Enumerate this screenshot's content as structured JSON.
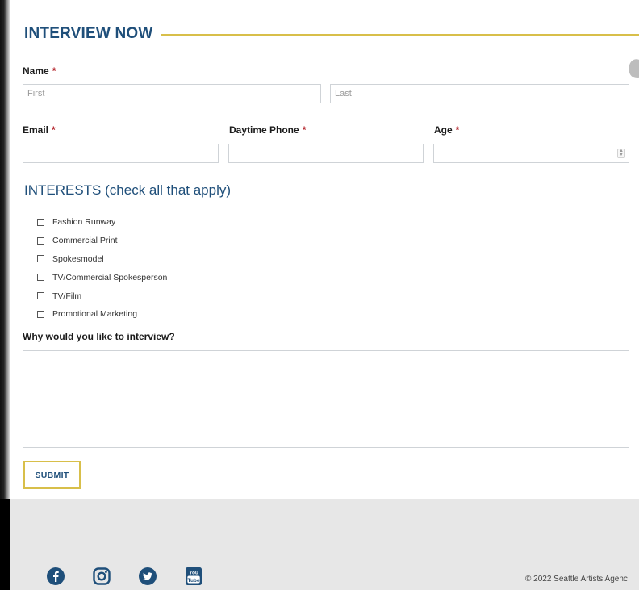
{
  "form": {
    "title": "INTERVIEW NOW",
    "name": {
      "label": "Name",
      "required_mark": "*",
      "first_placeholder": "First",
      "last_placeholder": "Last"
    },
    "email": {
      "label": "Email",
      "required_mark": "*"
    },
    "phone": {
      "label": "Daytime Phone",
      "required_mark": "*"
    },
    "age": {
      "label": "Age",
      "required_mark": "*"
    },
    "interests": {
      "title": "INTERESTS (check all that apply)",
      "options": [
        {
          "label": "Fashion Runway",
          "checked": false
        },
        {
          "label": "Commercial Print",
          "checked": false
        },
        {
          "label": "Spokesmodel",
          "checked": false
        },
        {
          "label": "TV/Commercial Spokesperson",
          "checked": false
        },
        {
          "label": "TV/Film",
          "checked": false
        },
        {
          "label": "Promotional Marketing",
          "checked": false
        }
      ]
    },
    "why": {
      "label": "Why would you like to interview?"
    },
    "submit_label": "SUBMIT"
  },
  "footer": {
    "social_icons": [
      "facebook-icon",
      "instagram-icon",
      "twitter-icon",
      "youtube-icon"
    ],
    "copyright": "© 2022 Seattle Artists Agenc"
  },
  "colors": {
    "accent_gold": "#d8bf4a",
    "heading_blue": "#1f4f7a",
    "required_red": "#b3232a",
    "footer_bg": "#e7e7e7"
  }
}
